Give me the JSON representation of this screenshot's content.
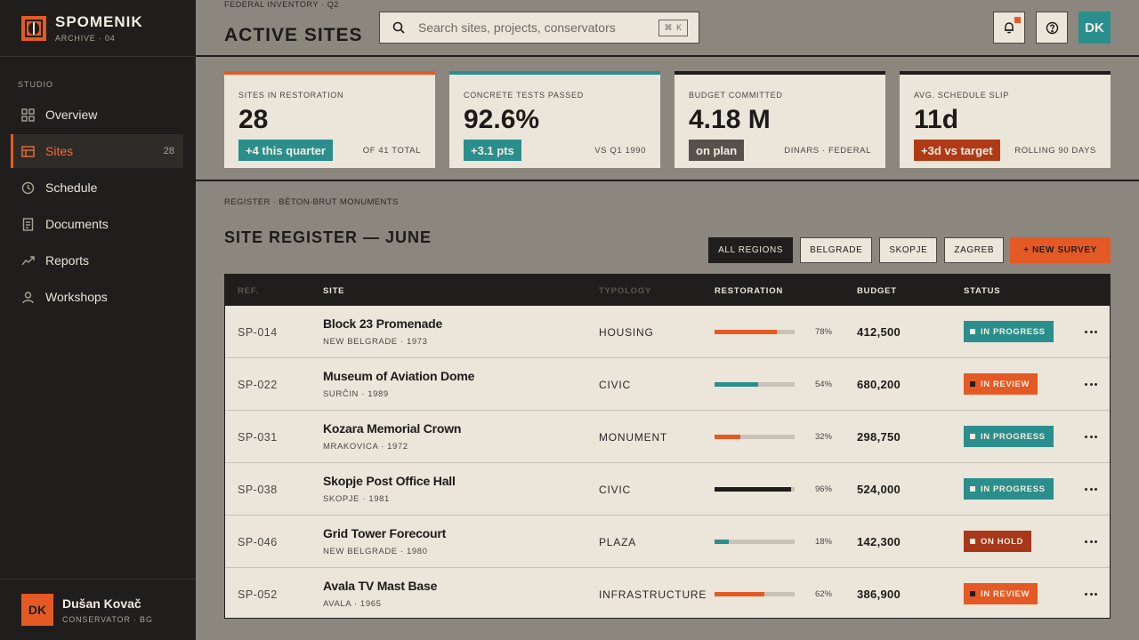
{
  "brand": {
    "name": "SPOMENIK",
    "sub": "ARCHIVE · 04"
  },
  "sidebar": {
    "section": "STUDIO",
    "items": [
      {
        "label": "Overview",
        "icon": "grid-icon"
      },
      {
        "label": "Sites",
        "icon": "layout-icon",
        "count": "28",
        "active": true
      },
      {
        "label": "Schedule",
        "icon": "clock-icon"
      },
      {
        "label": "Documents",
        "icon": "document-icon"
      },
      {
        "label": "Reports",
        "icon": "trend-icon"
      },
      {
        "label": "Workshops",
        "icon": "person-icon"
      }
    ]
  },
  "user": {
    "initials": "DK",
    "name": "Dušan Kovač",
    "role": "CONSERVATOR · BG"
  },
  "header": {
    "eyebrow": "FEDERAL INVENTORY · Q2",
    "title": "ACTIVE SITES",
    "search_placeholder": "Search sites, projects, conservators",
    "search_shortcut": "⌘ K",
    "avatar": "DK"
  },
  "kpis": [
    {
      "label": "SITES IN RESTORATION",
      "value": "28",
      "badge": "+4 this quarter",
      "note": "OF 41 TOTAL",
      "accent": "#e55a24",
      "badge_color": "#2a8f8c"
    },
    {
      "label": "CONCRETE TESTS PASSED",
      "value": "92.6%",
      "badge": "+3.1 pts",
      "note": "VS Q1 1990",
      "accent": "#2a8f8c",
      "badge_color": "#2a8f8c"
    },
    {
      "label": "BUDGET COMMITTED",
      "value": "4.18 M",
      "badge": "on plan",
      "note": "DINARS · FEDERAL",
      "accent": "#1f1e1c",
      "badge_color": "#55524c"
    },
    {
      "label": "AVG. SCHEDULE SLIP",
      "value": "11d",
      "badge": "+3d vs target",
      "note": "ROLLING 90 DAYS",
      "accent": "#1f1e1c",
      "badge_color": "#b03a16"
    }
  ],
  "register": {
    "eyebrow": "REGISTER · BÉTON-BRUT MONUMENTS",
    "title": "SITE REGISTER — JUNE",
    "filters": [
      "ALL REGIONS",
      "BELGRADE",
      "SKOPJE",
      "ZAGREB"
    ],
    "new_survey": "+ NEW SURVEY",
    "columns": [
      "REF.",
      "SITE",
      "TYPOLOGY",
      "RESTORATION",
      "BUDGET",
      "STATUS"
    ],
    "rows": [
      {
        "ref": "SP-014",
        "name": "Block 23 Promenade",
        "loc": "NEW BELGRADE · 1973",
        "type": "HOUSING",
        "pct_label": "78%",
        "pct": 0.78,
        "bar_color": "#e55a24",
        "budget": "412,500",
        "status": "IN PROGRESS",
        "status_color": "#2a8f8c",
        "sq_color": "#f2ece1"
      },
      {
        "ref": "SP-022",
        "name": "Museum of Aviation Dome",
        "loc": "SURČIN · 1989",
        "type": "CIVIC",
        "pct_label": "54%",
        "pct": 0.54,
        "bar_color": "#2a8f8c",
        "budget": "680,200",
        "status": "IN REVIEW",
        "status_color": "#e55a24",
        "sq_color": "#1f1e1c"
      },
      {
        "ref": "SP-031",
        "name": "Kozara Memorial Crown",
        "loc": "MRAKOVICA · 1972",
        "type": "MONUMENT",
        "pct_label": "32%",
        "pct": 0.32,
        "bar_color": "#e55a24",
        "budget": "298,750",
        "status": "IN PROGRESS",
        "status_color": "#2a8f8c",
        "sq_color": "#f2ece1"
      },
      {
        "ref": "SP-038",
        "name": "Skopje Post Office Hall",
        "loc": "SKOPJE · 1981",
        "type": "CIVIC",
        "pct_label": "96%",
        "pct": 0.96,
        "bar_color": "#1f1e1c",
        "budget": "524,000",
        "status": "IN PROGRESS",
        "status_color": "#2a8f8c",
        "sq_color": "#f2ece1"
      },
      {
        "ref": "SP-046",
        "name": "Grid Tower Forecourt",
        "loc": "NEW BELGRADE · 1980",
        "type": "PLAZA",
        "pct_label": "18%",
        "pct": 0.18,
        "bar_color": "#2a8f8c",
        "budget": "142,300",
        "status": "ON HOLD",
        "status_color": "#a8371a",
        "sq_color": "#f2ece1"
      },
      {
        "ref": "SP-052",
        "name": "Avala TV Mast Base",
        "loc": "AVALA · 1965",
        "type": "INFRASTRUCTURE",
        "pct_label": "62%",
        "pct": 0.62,
        "bar_color": "#e55a24",
        "budget": "386,900",
        "status": "IN REVIEW",
        "status_color": "#e55a24",
        "sq_color": "#1f1e1c"
      }
    ]
  }
}
